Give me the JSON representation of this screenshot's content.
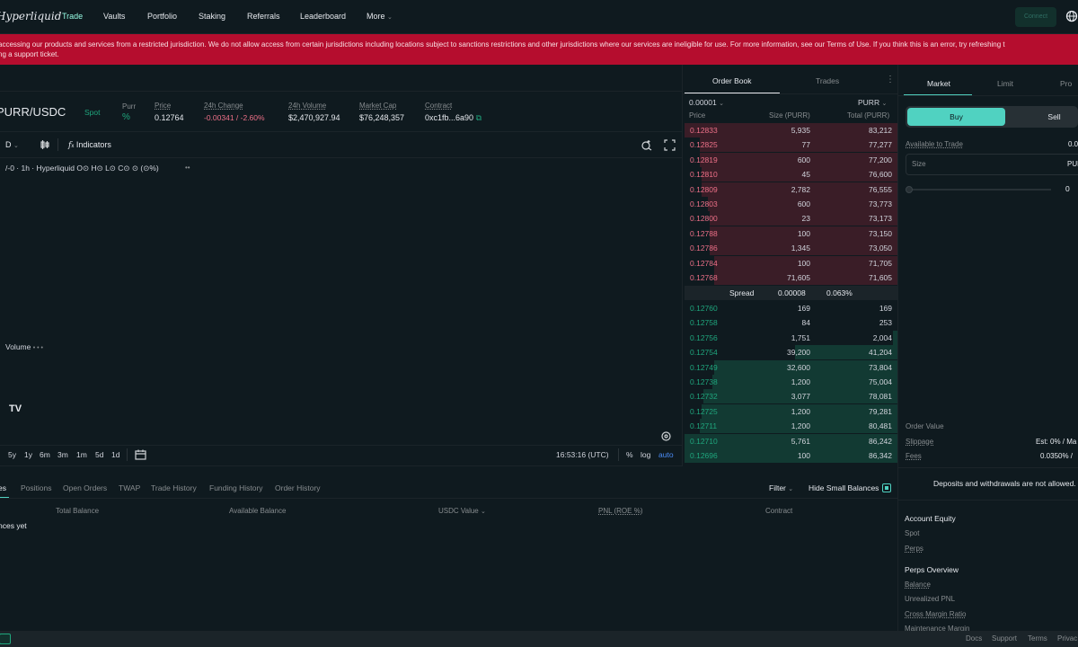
{
  "nav": {
    "logo": "Hyperliquid",
    "items": [
      {
        "label": "Trade",
        "active": true
      },
      {
        "label": "Vaults"
      },
      {
        "label": "Portfolio"
      },
      {
        "label": "Staking"
      },
      {
        "label": "Referrals"
      },
      {
        "label": "Leaderboard"
      },
      {
        "label": "More"
      }
    ],
    "connect_label": "Connect"
  },
  "banner": {
    "line1": "accessing our products and services from a restricted jurisdiction. We do not allow access from certain jurisdictions including locations subject to sanctions restrictions and other jurisdictions where our services are ineligible for use. For more information, see our Terms of Use. If you think this is an error, try refreshing t",
    "line2": "ng a support ticket."
  },
  "market": {
    "pair": "PURR/USDC",
    "type": "Spot",
    "token": "Purr",
    "price_label": "Price",
    "price": "0.12764",
    "change_label": "24h Change",
    "change": "-0.00341 / -2.60%",
    "volume_label": "24h Volume",
    "volume": "$2,470,927.94",
    "mcap_label": "Market Cap",
    "mcap": "$76,248,357",
    "contract_label": "Contract",
    "contract": "0xc1fb...6a90"
  },
  "chart": {
    "interval": "D",
    "indicators_label": "Indicators",
    "legend": "/-0 · 1h · Hyperliquid  O⊙ H⊙ L⊙ C⊙ ⊙ (⊙%)",
    "volume_label": "Volume",
    "ranges": [
      "5y",
      "1y",
      "6m",
      "3m",
      "1m",
      "5d",
      "1d"
    ],
    "time": "16:53:16 (UTC)",
    "pct": "%",
    "log": "log",
    "auto": "auto"
  },
  "orderbook": {
    "tabs": [
      "Order Book",
      "Trades"
    ],
    "tick": "0.00001",
    "unit": "PURR",
    "headers": [
      "Price",
      "Size (PURR)",
      "Total (PURR)"
    ],
    "asks": [
      {
        "price": "0.12833",
        "size": "5,935",
        "total": "83,212",
        "depth": 1.0
      },
      {
        "price": "0.12825",
        "size": "77",
        "total": "77,277",
        "depth": 0.93
      },
      {
        "price": "0.12819",
        "size": "600",
        "total": "77,200",
        "depth": 0.93
      },
      {
        "price": "0.12810",
        "size": "45",
        "total": "76,600",
        "depth": 0.92
      },
      {
        "price": "0.12809",
        "size": "2,782",
        "total": "76,555",
        "depth": 0.92
      },
      {
        "price": "0.12803",
        "size": "600",
        "total": "73,773",
        "depth": 0.89
      },
      {
        "price": "0.12800",
        "size": "23",
        "total": "73,173",
        "depth": 0.88
      },
      {
        "price": "0.12788",
        "size": "100",
        "total": "73,150",
        "depth": 0.88
      },
      {
        "price": "0.12786",
        "size": "1,345",
        "total": "73,050",
        "depth": 0.88
      },
      {
        "price": "0.12784",
        "size": "100",
        "total": "71,705",
        "depth": 0.86
      },
      {
        "price": "0.12768",
        "size": "71,605",
        "total": "71,605",
        "depth": 0.86
      }
    ],
    "spread_label": "Spread",
    "spread": "0.00008",
    "spread_pct": "0.063%",
    "bids": [
      {
        "price": "0.12760",
        "size": "169",
        "total": "169",
        "depth": 0.0
      },
      {
        "price": "0.12758",
        "size": "84",
        "total": "253",
        "depth": 0.0
      },
      {
        "price": "0.12756",
        "size": "1,751",
        "total": "2,004",
        "depth": 0.02
      },
      {
        "price": "0.12754",
        "size": "39,200",
        "total": "41,204",
        "depth": 0.48
      },
      {
        "price": "0.12749",
        "size": "32,600",
        "total": "73,804",
        "depth": 0.86
      },
      {
        "price": "0.12738",
        "size": "1,200",
        "total": "75,004",
        "depth": 0.87
      },
      {
        "price": "0.12732",
        "size": "3,077",
        "total": "78,081",
        "depth": 0.91
      },
      {
        "price": "0.12725",
        "size": "1,200",
        "total": "79,281",
        "depth": 0.92
      },
      {
        "price": "0.12711",
        "size": "1,200",
        "total": "80,481",
        "depth": 0.93
      },
      {
        "price": "0.12710",
        "size": "5,761",
        "total": "86,242",
        "depth": 1.0
      },
      {
        "price": "0.12696",
        "size": "100",
        "total": "86,342",
        "depth": 1.0
      }
    ]
  },
  "order_form": {
    "tabs": [
      "Market",
      "Limit",
      "Pro"
    ],
    "buy": "Buy",
    "sell": "Sell",
    "available_label": "Available to Trade",
    "available": "0.0",
    "size_label": "Size",
    "size_unit": "PUR",
    "slider_val": "0",
    "order_value_label": "Order Value",
    "slippage_label": "Slippage",
    "slippage": "Est: 0% / Ma",
    "fees_label": "Fees",
    "fees": "0.0350% /",
    "deposits_note": "Deposits and withdrawals are not allowed.",
    "equity_title": "Account Equity",
    "spot_label": "Spot",
    "perps_label": "Perps",
    "perps_overview": "Perps Overview",
    "balance_label": "Balance",
    "upnl_label": "Unrealized PNL",
    "cmr_label": "Cross Margin Ratio",
    "mm_label": "Maintenance Margin"
  },
  "bottom": {
    "tabs": [
      "es",
      "Positions",
      "Open Orders",
      "TWAP",
      "Trade History",
      "Funding History",
      "Order History"
    ],
    "filter": "Filter",
    "hide_small": "Hide Small Balances",
    "columns": [
      "Total Balance",
      "Available Balance",
      "USDC Value",
      "PNL (ROE %)",
      "Contract"
    ],
    "empty": "nces yet"
  },
  "footer": {
    "links": [
      "Docs",
      "Support",
      "Terms",
      "Privac"
    ]
  }
}
